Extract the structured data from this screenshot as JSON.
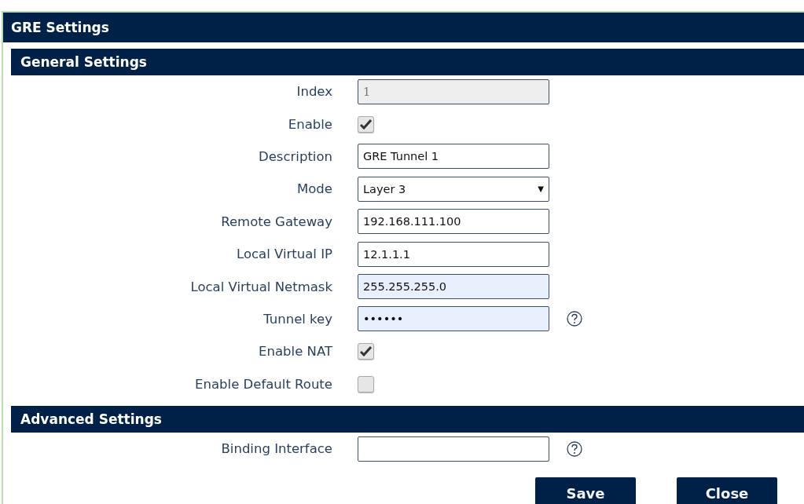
{
  "title": "GRE Settings",
  "sections": [
    {
      "heading": "General Settings",
      "fields": [
        {
          "kind": "text",
          "label": "Index",
          "value": "1",
          "disabled": true,
          "autofilled": false,
          "help": false
        },
        {
          "kind": "checkbox",
          "label": "Enable",
          "checked": true
        },
        {
          "kind": "text",
          "label": "Description",
          "value": "GRE Tunnel 1",
          "disabled": false,
          "autofilled": false,
          "help": false
        },
        {
          "kind": "select",
          "label": "Mode",
          "value": "Layer 3",
          "caret": "▼"
        },
        {
          "kind": "text",
          "label": "Remote Gateway",
          "value": "192.168.111.100",
          "disabled": false,
          "autofilled": false,
          "help": false
        },
        {
          "kind": "text",
          "label": "Local Virtual IP",
          "value": "12.1.1.1",
          "disabled": false,
          "autofilled": false,
          "help": false
        },
        {
          "kind": "text",
          "label": "Local Virtual Netmask",
          "value": "255.255.255.0",
          "disabled": false,
          "autofilled": true,
          "help": false
        },
        {
          "kind": "text",
          "label": "Tunnel key",
          "value": "••••••",
          "disabled": false,
          "autofilled": true,
          "help": true
        },
        {
          "kind": "checkbox",
          "label": "Enable NAT",
          "checked": true
        },
        {
          "kind": "checkbox",
          "label": "Enable Default Route",
          "checked": false
        }
      ]
    },
    {
      "heading": "Advanced Settings",
      "fields": [
        {
          "kind": "text",
          "label": "Binding Interface",
          "disabled": false,
          "autofilled": false,
          "help": true
        }
      ]
    }
  ],
  "buttons": [
    "Save",
    "Close"
  ]
}
